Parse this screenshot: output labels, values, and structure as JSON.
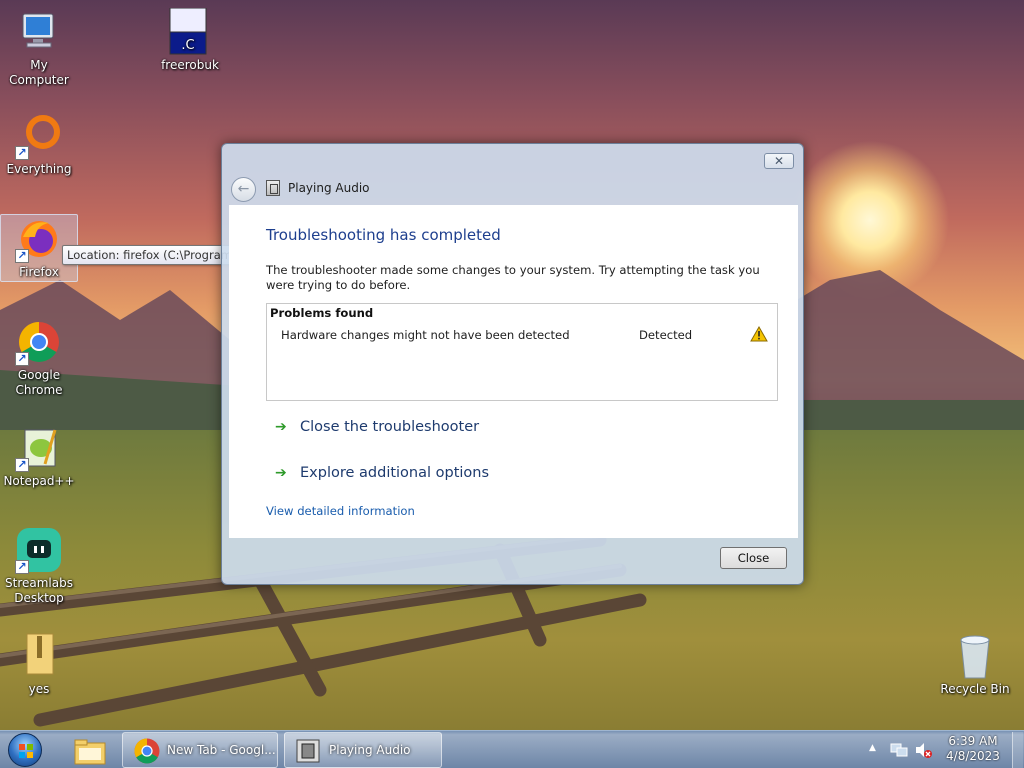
{
  "desktop": {
    "icons": [
      {
        "label": "My Computer"
      },
      {
        "label": "freerobuk",
        "glyph": ".C"
      },
      {
        "label": "Everything"
      },
      {
        "label": "Firefox"
      },
      {
        "label": "Google Chrome"
      },
      {
        "label": "Notepad++"
      },
      {
        "label": "Streamlabs Desktop"
      },
      {
        "label": "yes"
      },
      {
        "label": "Recycle Bin"
      }
    ],
    "tooltip": "Location: firefox (C:\\Program Files\\Mozilla Firefox)"
  },
  "dialog": {
    "close_glyph": "✕",
    "back_glyph": "←",
    "nav_title": "Playing Audio",
    "heading": "Troubleshooting has completed",
    "description": "The troubleshooter made some changes to your system. Try attempting the task you were trying to do before.",
    "problems": {
      "header": "Problems found",
      "rows": [
        {
          "name": "Hardware changes might not have been detected",
          "status": "Detected",
          "icon": "warning-icon"
        }
      ]
    },
    "commands": [
      {
        "label": "Close the troubleshooter",
        "icon": "green-arrow-icon"
      },
      {
        "label": "Explore additional options",
        "icon": "green-arrow-icon"
      }
    ],
    "arrow_glyph": "➔",
    "detail_link": "View detailed information",
    "close_button": "Close"
  },
  "taskbar": {
    "buttons": [
      {
        "label": "New Tab - Googl..."
      },
      {
        "label": "Playing Audio"
      }
    ],
    "tray_arrow": "▲",
    "clock": {
      "time": "6:39 AM",
      "date": "4/8/2023"
    }
  },
  "colors": {
    "heading": "#1e3f8e",
    "link": "#1a5dad",
    "command_arrow": "#2e9a2a",
    "warning": "#f5c400"
  }
}
